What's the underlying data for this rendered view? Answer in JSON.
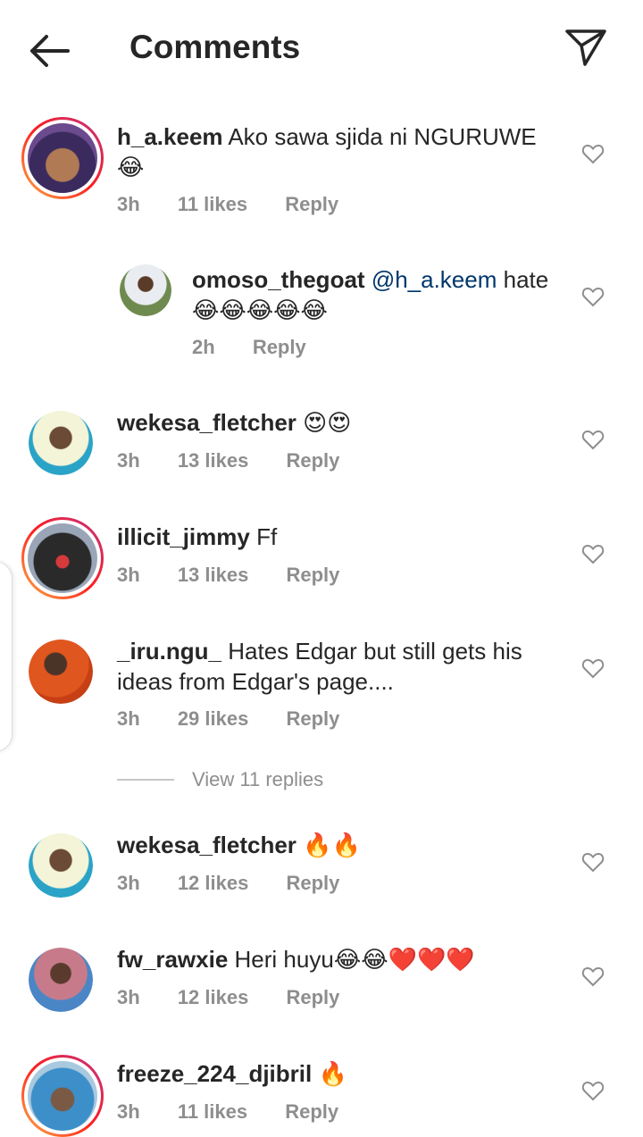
{
  "header": {
    "title": "Comments",
    "back_icon": "arrow-left-icon",
    "send_icon": "paper-plane-icon"
  },
  "comments": [
    {
      "user": "h_a.keem",
      "text": "Ako sawa sjida ni NGURUWE",
      "emoji": "😂",
      "time": "3h",
      "likes": "11 likes",
      "reply": "Reply"
    },
    {
      "user": "omoso_thegoat",
      "mention": "@h_a.keem",
      "text": "hate",
      "emoji": "😂😂😂😂😂",
      "time": "2h",
      "reply": "Reply"
    },
    {
      "user": "wekesa_fletcher",
      "text": "",
      "emoji": "😍😍",
      "time": "3h",
      "likes": "13 likes",
      "reply": "Reply"
    },
    {
      "user": "illicit_jimmy",
      "text": "Ff",
      "time": "3h",
      "likes": "13 likes",
      "reply": "Reply"
    },
    {
      "user": "_iru.ngu_",
      "text": "Hates Edgar but still gets his",
      "text2": "ideas from Edgar's page....",
      "time": "3h",
      "likes": "29 likes",
      "reply": "Reply"
    },
    {
      "user": "wekesa_fletcher",
      "text": "",
      "emoji": "🔥🔥",
      "time": "3h",
      "likes": "12 likes",
      "reply": "Reply"
    },
    {
      "user": "fw_rawxie",
      "text": "Heri huyu",
      "emoji": "😂😂❤️❤️❤️",
      "time": "3h",
      "likes": "12 likes",
      "reply": "Reply"
    },
    {
      "user": "freeze_224_djibril",
      "text": "",
      "emoji": "🔥",
      "time": "3h",
      "likes": "11 likes",
      "reply": "Reply"
    }
  ],
  "view_replies": "View 11 replies",
  "colors": {
    "text": "#262626",
    "meta": "#8e8e8e",
    "mention": "#00376b",
    "story_ring_start": "#fcb045",
    "story_ring_end": "#c13584"
  }
}
